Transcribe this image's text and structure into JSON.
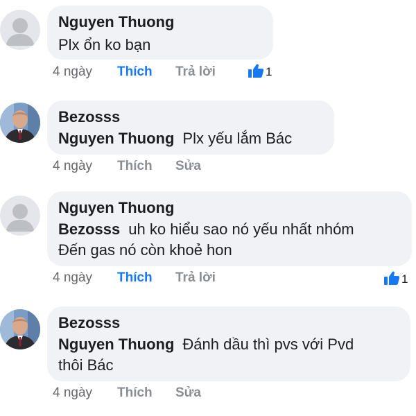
{
  "comments": [
    {
      "author": "Nguyen Thuong",
      "mention": "",
      "lines": [
        "Plx ổn ko bạn"
      ],
      "time": "4 ngày",
      "like_label": "Thích",
      "liked": true,
      "second_action": "Trả lời",
      "reaction_count": "1",
      "avatar": "default-avatar"
    },
    {
      "author": "Bezosss",
      "mention": "Nguyen Thuong",
      "lines": [
        "Plx yếu lắm Bác"
      ],
      "time": "4 ngày",
      "like_label": "Thích",
      "liked": false,
      "second_action": "Sửa",
      "reaction_count": "",
      "avatar": "photo-avatar"
    },
    {
      "author": "Nguyen Thuong",
      "mention": "Bezosss",
      "lines": [
        "uh ko hiểu sao nó yếu nhất nhóm",
        "Đến gas nó còn khoẻ hon"
      ],
      "time": "4 ngày",
      "like_label": "Thích",
      "liked": true,
      "second_action": "Trả lời",
      "reaction_count": "1",
      "avatar": "default-avatar"
    },
    {
      "author": "Bezosss",
      "mention": "Nguyen Thuong",
      "lines": [
        "Đánh dầu thì pvs với Pvd",
        "thôi Bác"
      ],
      "time": "4 ngày",
      "like_label": "Thích",
      "liked": false,
      "second_action": "Sửa",
      "reaction_count": "",
      "avatar": "photo-avatar"
    }
  ],
  "colors": {
    "bubble": "#f0f2f5",
    "liked": "#1877f2",
    "muted": "#65676b",
    "action": "#8a8d91"
  }
}
